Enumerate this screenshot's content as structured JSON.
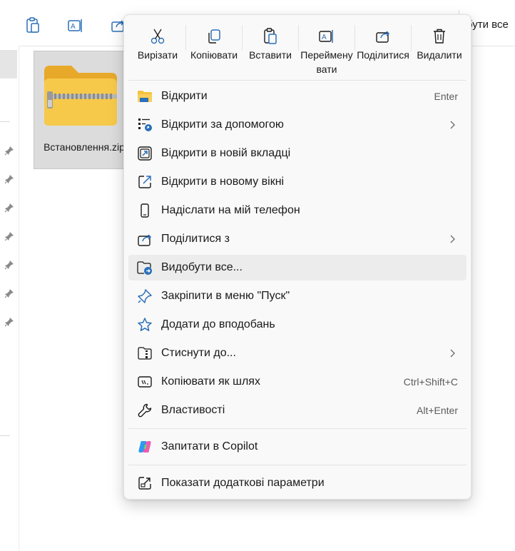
{
  "explorer": {
    "toolbar": {
      "extract_all_label": "бути все",
      "icons": [
        "clipboard-icon",
        "rename-icon",
        "share-icon"
      ]
    },
    "file": {
      "name": "Встановлення.zip"
    }
  },
  "context_menu": {
    "quick_actions": [
      {
        "label": "Вирізати",
        "icon": "scissors-icon"
      },
      {
        "label": "Копіювати",
        "icon": "copy-icon"
      },
      {
        "label": "Вставити",
        "icon": "paste-icon"
      },
      {
        "label": "Перейменувати",
        "icon": "rename-icon"
      },
      {
        "label": "Поділитися",
        "icon": "share-icon"
      },
      {
        "label": "Видалити",
        "icon": "trash-icon"
      }
    ],
    "items": [
      {
        "label": "Відкрити",
        "shortcut": "Enter",
        "icon": "folder-icon"
      },
      {
        "label": "Відкрити за допомогою",
        "shortcut": "",
        "icon": "open-with-icon",
        "submenu": true
      },
      {
        "label": "Відкрити в новій вкладці",
        "shortcut": "",
        "icon": "new-tab-icon"
      },
      {
        "label": "Відкрити в новому вікні",
        "shortcut": "",
        "icon": "new-window-icon"
      },
      {
        "label": "Надіслати на мій телефон",
        "shortcut": "",
        "icon": "phone-icon"
      },
      {
        "label": "Поділитися з",
        "shortcut": "",
        "icon": "share-icon",
        "submenu": true
      },
      {
        "label": "Видобути все...",
        "shortcut": "",
        "icon": "extract-icon",
        "highlighted": true
      },
      {
        "label": "Закріпити в меню \"Пуск\"",
        "shortcut": "",
        "icon": "pin-icon"
      },
      {
        "label": "Додати до вподобань",
        "shortcut": "",
        "icon": "star-icon"
      },
      {
        "label": "Стиснути до...",
        "shortcut": "",
        "icon": "compress-icon",
        "submenu": true
      },
      {
        "label": "Копіювати як шлях",
        "shortcut": "Ctrl+Shift+C",
        "icon": "copy-path-icon"
      },
      {
        "label": "Властивості",
        "shortcut": "Alt+Enter",
        "icon": "wrench-icon"
      }
    ],
    "copilot": {
      "label": "Запитати в Copilot",
      "icon": "copilot-icon"
    },
    "more": {
      "label": "Показати додаткові параметри",
      "icon": "more-options-icon"
    }
  },
  "colors": {
    "accent": "#0067c0",
    "menu_bg": "#f9f9f9",
    "hover_bg": "#ececec",
    "selection_bg": "#dcdcdc",
    "folder_yellow": "#f5c23d"
  }
}
